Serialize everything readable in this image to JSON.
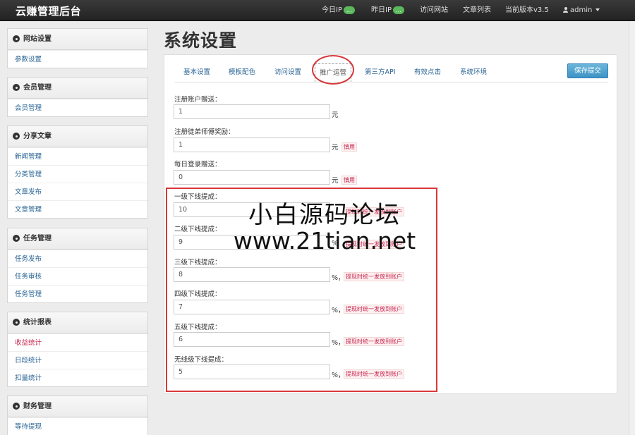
{
  "header": {
    "brand": "云赚管理后台",
    "today_ip_label": "今日IP",
    "today_ip_value": "...",
    "yesterday_ip_label": "昨日IP",
    "yesterday_ip_value": "...",
    "visit_site": "访问网站",
    "article_list": "文章列表",
    "version": "当前版本v3.5",
    "user": "admin"
  },
  "sidebar": {
    "groups": [
      {
        "title": "网站设置",
        "items": [
          "参数设置"
        ]
      },
      {
        "title": "会员管理",
        "items": [
          "会员管理"
        ]
      },
      {
        "title": "分享文章",
        "items": [
          "新闻管理",
          "分类管理",
          "文章发布",
          "文章管理"
        ]
      },
      {
        "title": "任务管理",
        "items": [
          "任务发布",
          "任务审核",
          "任务管理"
        ]
      },
      {
        "title": "统计报表",
        "items": [
          "收益统计",
          "日段统计",
          "扣量统计"
        ]
      },
      {
        "title": "财务管理",
        "items": [
          "等待提现"
        ]
      }
    ]
  },
  "main": {
    "title": "系统设置",
    "tabs": [
      "基本设置",
      "模板配色",
      "访问设置",
      "推广运营",
      "第三方API",
      "有效点击",
      "系统环境"
    ],
    "active_tab": "推广运营",
    "save_label": "保存提交",
    "fields": [
      {
        "label": "注册账户赠送：",
        "value": "1",
        "unit": "元",
        "hint": ""
      },
      {
        "label": "注册徒弟师傅奖励：",
        "value": "1",
        "unit": "元",
        "hint": "慎用"
      },
      {
        "label": "每日登录赠送：",
        "value": "0",
        "unit": "元",
        "hint": "慎用"
      },
      {
        "label": "一级下线提成：",
        "value": "10",
        "unit": "",
        "hint": "提现时统一发放到账户"
      },
      {
        "label": "二级下线提成：",
        "value": "9",
        "unit": "%",
        "hint": "提现时统一发放到账户"
      },
      {
        "label": "三级下线提成：",
        "value": "8",
        "unit": "%，",
        "hint": "提现时统一发放到账户"
      },
      {
        "label": "四级下线提成：",
        "value": "7",
        "unit": "%，",
        "hint": "提现时统一发放到账户"
      },
      {
        "label": "五级下线提成：",
        "value": "6",
        "unit": "%，",
        "hint": "提现时统一发放到账户"
      },
      {
        "label": "无线级下线提成：",
        "value": "5",
        "unit": "%，",
        "hint": "提现时统一发放到账户"
      }
    ]
  },
  "watermark": {
    "line1": "小白源码论坛",
    "line2": "www.21tian.net"
  },
  "colors": {
    "topbar": "#2c2c2c",
    "link": "#2a6496",
    "annotation_red": "#d9383a",
    "hint_red": "#c7254e",
    "badge_green": "#5cb85c"
  }
}
